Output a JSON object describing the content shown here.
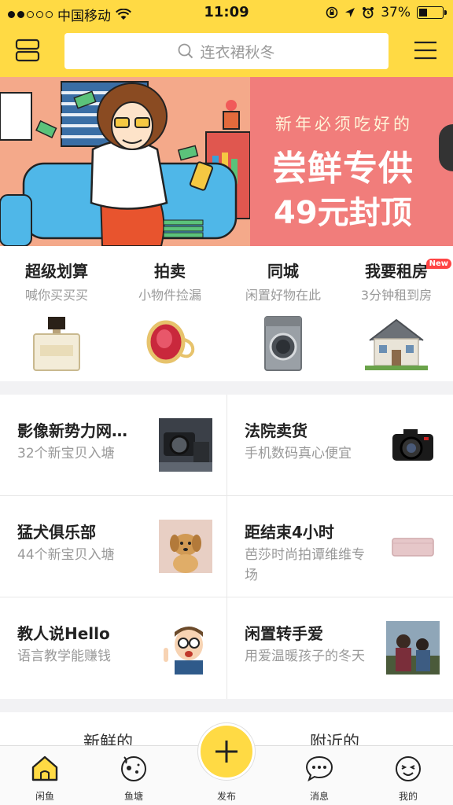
{
  "status_bar": {
    "carrier": "中国移动",
    "time": "11:09",
    "battery": "37%",
    "battery_level": 0.37
  },
  "header": {
    "search_placeholder": "连衣裙秋冬"
  },
  "banner": {
    "sub": "新年必须吃好的",
    "line1": "尝鲜专供",
    "line2": "49元封顶",
    "colors": {
      "left": "#f6b08c",
      "right": "#f17d7b"
    }
  },
  "categories": [
    {
      "title": "超级划算",
      "subtitle": "喊你买买买",
      "icon": "perfume"
    },
    {
      "title": "拍卖",
      "subtitle": "小物件捡漏",
      "icon": "ring"
    },
    {
      "title": "同城",
      "subtitle": "闲置好物在此",
      "icon": "washing-machine"
    },
    {
      "title": "我要租房",
      "subtitle": "3分钟租到房",
      "icon": "house",
      "badge": "New"
    }
  ],
  "topics": [
    {
      "title": "影像新势力网…",
      "subtitle": "32个新宝贝入塘",
      "icon": "camera-gear"
    },
    {
      "title": "法院卖货",
      "subtitle": "手机数码真心便宜",
      "icon": "dslr-camera"
    },
    {
      "title": "猛犬俱乐部",
      "subtitle": "44个新宝贝入塘",
      "icon": "puppy"
    },
    {
      "title": "距结束4小时",
      "subtitle": "芭莎时尚拍谭维维专场",
      "icon": "pink-wallet"
    },
    {
      "title": "教人说Hello",
      "subtitle": "语言教学能赚钱",
      "icon": "boy-with-glasses"
    },
    {
      "title": "闲置转手爱",
      "subtitle": "用爱温暖孩子的冬天",
      "icon": "children-photo"
    }
  ],
  "feed_tabs": [
    "新鲜的",
    "附近的"
  ],
  "nav": {
    "home": "闲鱼",
    "pond": "鱼塘",
    "publish": "发布",
    "messages": "消息",
    "mine": "我的"
  },
  "colors": {
    "accent": "#ffda44"
  }
}
